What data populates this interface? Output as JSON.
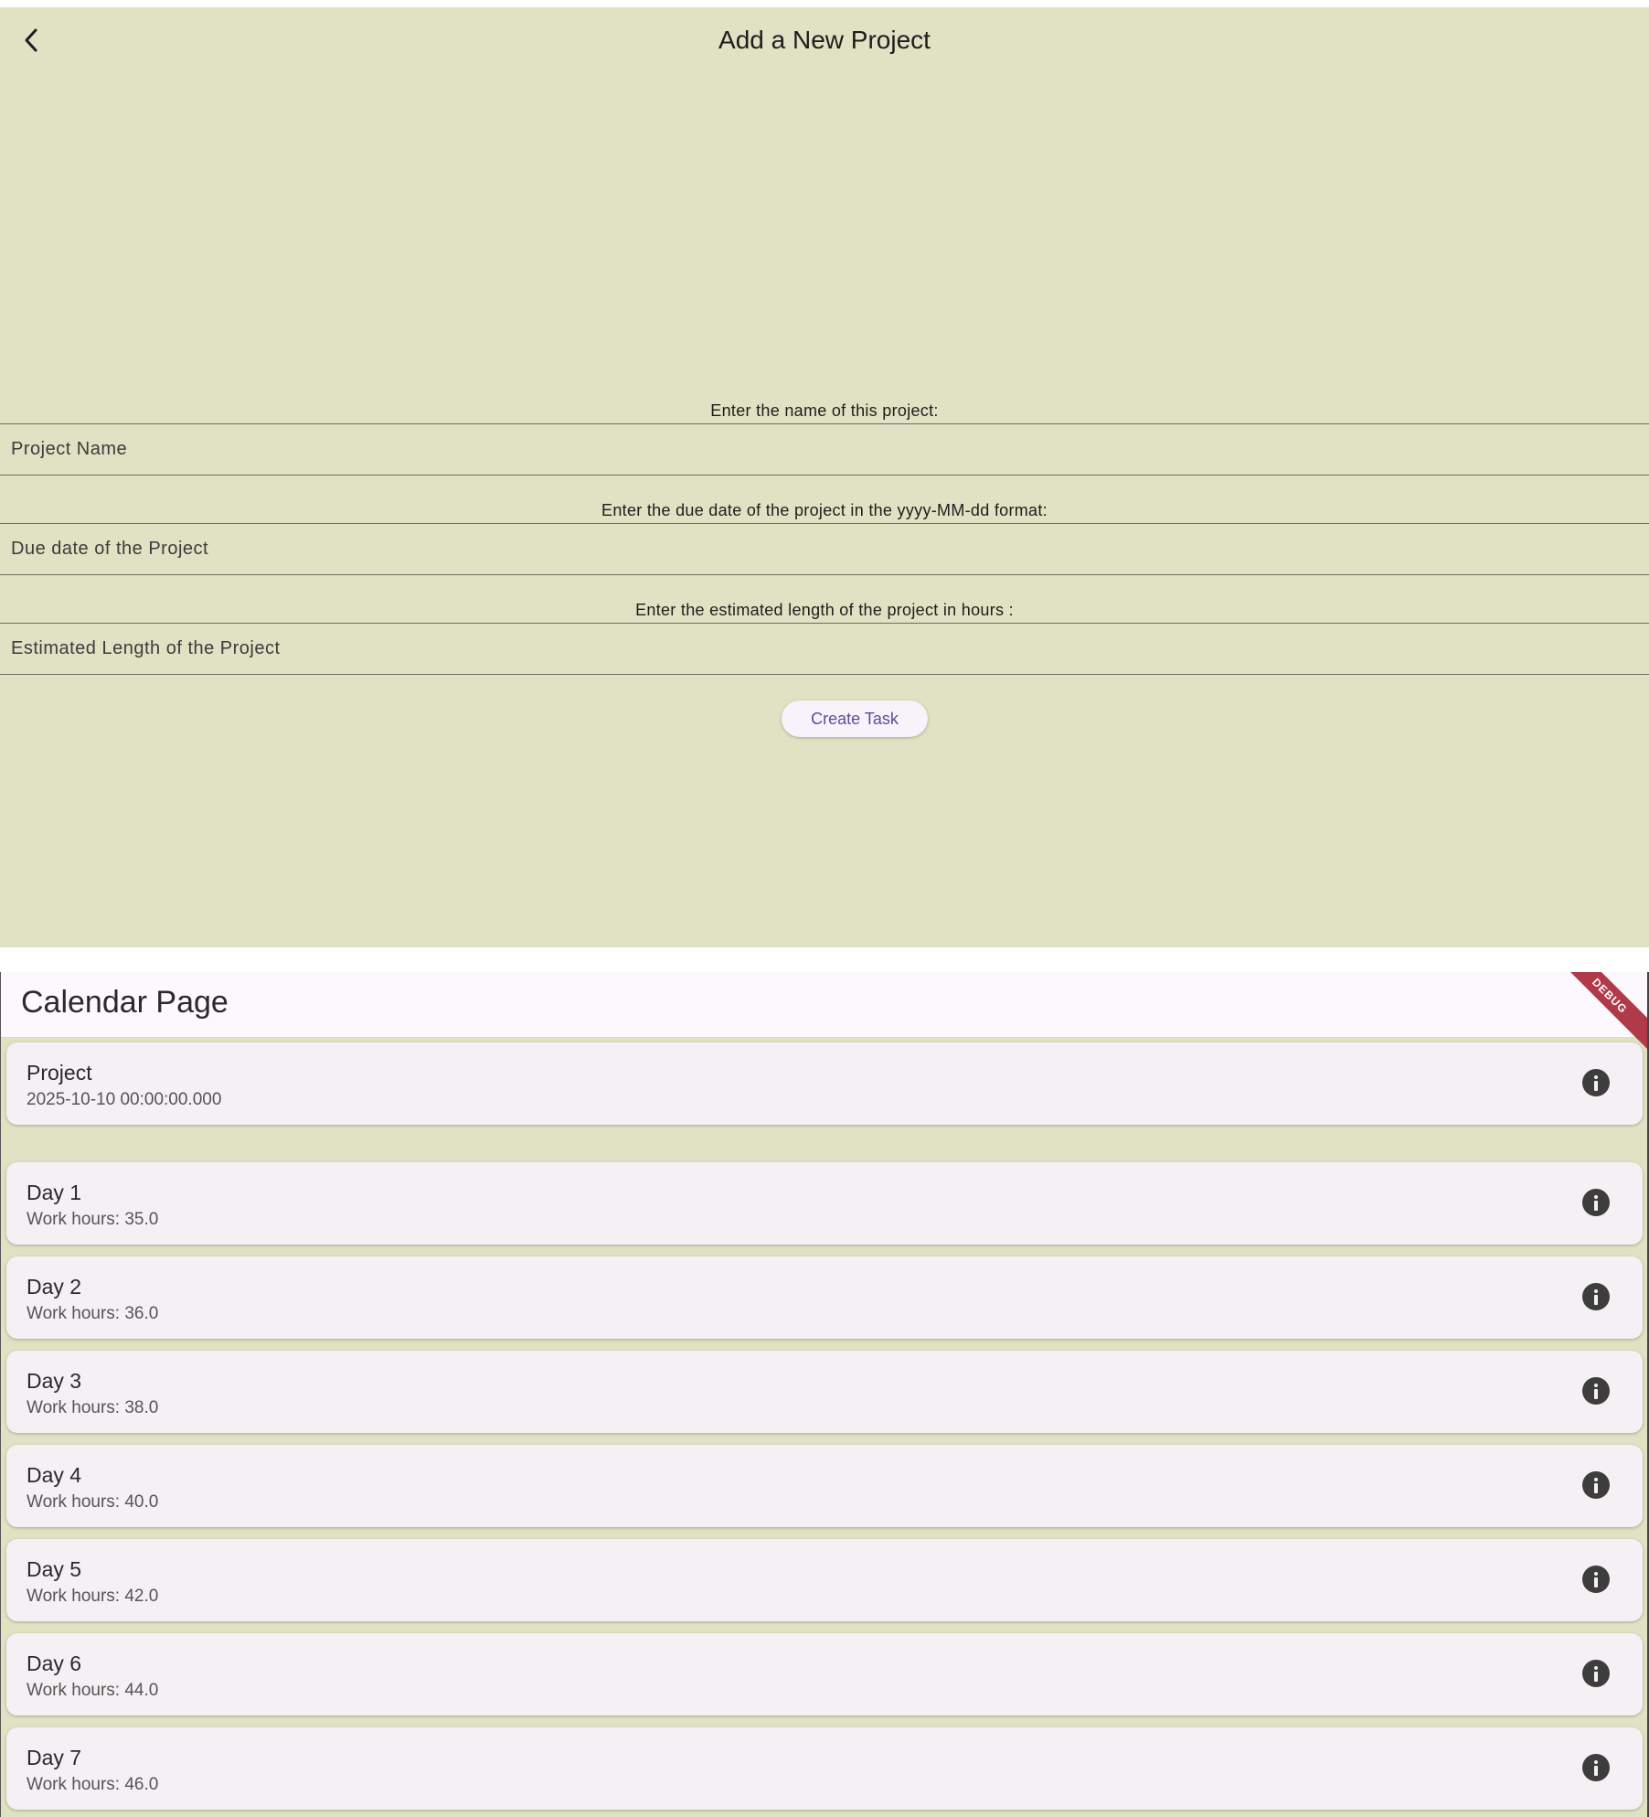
{
  "add_project": {
    "title": "Add a New Project",
    "name_label": "Enter the name of this project:",
    "name_placeholder": "Project Name",
    "due_label": "Enter the due date of the project in the yyyy-MM-dd format:",
    "due_placeholder": "Due date of the Project",
    "length_label": "Enter the estimated length of the project in hours :",
    "length_placeholder": "Estimated Length of the Project",
    "create_button": "Create Task",
    "icons": {
      "back": "chevron-left-icon"
    },
    "colors": {
      "background": "#e1e1c3",
      "button_text": "#5f4a9b"
    }
  },
  "calendar": {
    "title": "Calendar Page",
    "debug_banner": "DEBUG",
    "project": {
      "title": "Project",
      "subtitle": "2025-10-10 00:00:00.000"
    },
    "days": [
      {
        "title": "Day 1",
        "subtitle": "Work hours: 35.0"
      },
      {
        "title": "Day 2",
        "subtitle": "Work hours: 36.0"
      },
      {
        "title": "Day 3",
        "subtitle": "Work hours: 38.0"
      },
      {
        "title": "Day 4",
        "subtitle": "Work hours: 40.0"
      },
      {
        "title": "Day 5",
        "subtitle": "Work hours: 42.0"
      },
      {
        "title": "Day 6",
        "subtitle": "Work hours: 44.0"
      },
      {
        "title": "Day 7",
        "subtitle": "Work hours: 46.0"
      }
    ],
    "icons": {
      "info": "info-icon"
    },
    "colors": {
      "card": "#f4f0f4",
      "header": "#fdf8fe",
      "debug": "#b03a48"
    }
  }
}
